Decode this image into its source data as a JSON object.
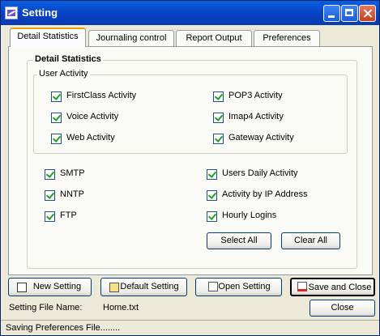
{
  "window": {
    "title": "Setting"
  },
  "tabs": [
    {
      "label": "Detail Statistics"
    },
    {
      "label": "Journaling control"
    },
    {
      "label": "Report Output"
    },
    {
      "label": "Preferences"
    }
  ],
  "detail": {
    "group_title": "Detail Statistics",
    "user_activity_title": "User Activity",
    "user_activity": [
      {
        "label": "FirstClass Activity",
        "checked": true
      },
      {
        "label": "POP3 Activity",
        "checked": true
      },
      {
        "label": "Voice Activity",
        "checked": true
      },
      {
        "label": "Imap4 Activity",
        "checked": true
      },
      {
        "label": "Web Activity",
        "checked": true
      },
      {
        "label": "Gateway Activity",
        "checked": true
      }
    ],
    "other": [
      {
        "label": "SMTP",
        "checked": true
      },
      {
        "label": "Users Daily Activity",
        "checked": true
      },
      {
        "label": "NNTP",
        "checked": true
      },
      {
        "label": "Activity by IP Address",
        "checked": true
      },
      {
        "label": "FTP",
        "checked": true
      },
      {
        "label": "Hourly Logins",
        "checked": true
      }
    ],
    "select_all": "Select All",
    "clear_all": "Clear All"
  },
  "bottom": {
    "new_setting": "New Setting",
    "default_setting": "Default Setting",
    "open_setting": "Open Setting",
    "save_and_close": "Save and Close",
    "file_name_label": "Setting File Name:",
    "file_name_value": "Home.txt",
    "close": "Close"
  },
  "status_text": "Saving Preferences File........"
}
